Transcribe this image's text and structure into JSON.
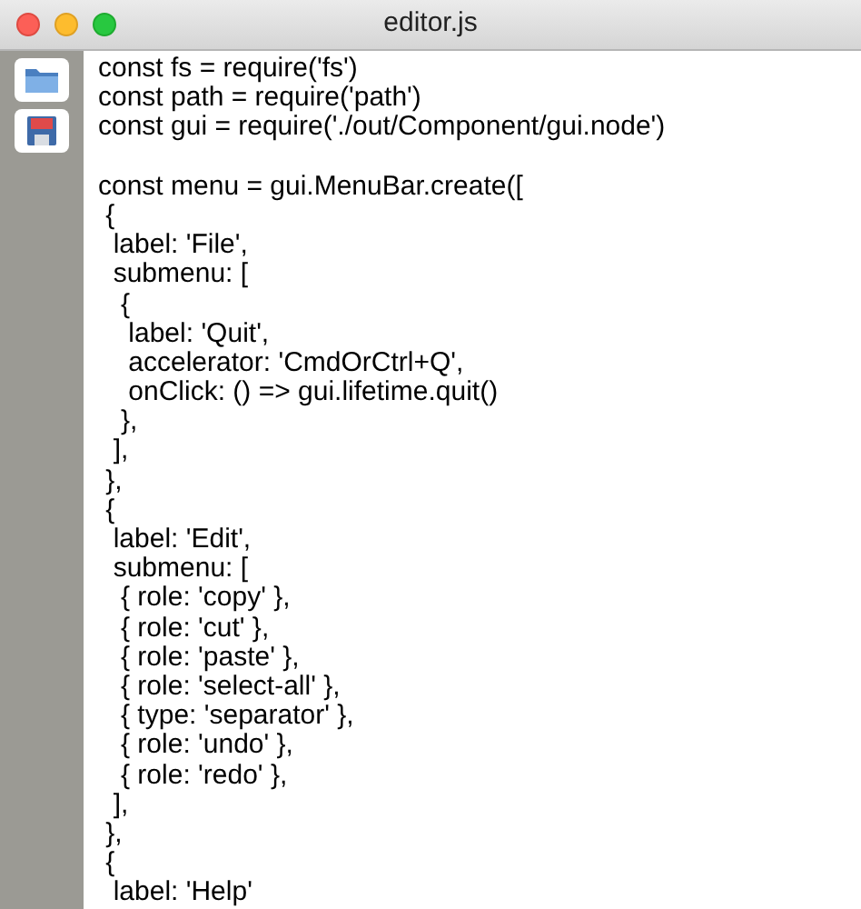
{
  "window": {
    "title": "editor.js"
  },
  "toolbar": [
    {
      "kind": "open"
    },
    {
      "kind": "save"
    }
  ],
  "editor": {
    "lines": [
      {
        "kind": "code",
        "text": "const fs = require('fs')"
      },
      {
        "kind": "code",
        "text": "const path = require('path')"
      },
      {
        "kind": "code",
        "text": "const gui = require('./out/Component/gui.node')"
      },
      {
        "kind": "blank"
      },
      {
        "kind": "code",
        "text": "const menu = gui.MenuBar.create(["
      },
      {
        "kind": "code",
        "text": " {"
      },
      {
        "kind": "code",
        "text": "  label: 'File',"
      },
      {
        "kind": "code",
        "text": "  submenu: ["
      },
      {
        "kind": "code",
        "text": "   {"
      },
      {
        "kind": "code",
        "text": "    label: 'Quit',"
      },
      {
        "kind": "code",
        "text": "    accelerator: 'CmdOrCtrl+Q',"
      },
      {
        "kind": "code",
        "text": "    onClick: () => gui.lifetime.quit()"
      },
      {
        "kind": "code",
        "text": "   },"
      },
      {
        "kind": "code",
        "text": "  ],"
      },
      {
        "kind": "code",
        "text": " },"
      },
      {
        "kind": "code",
        "text": " {"
      },
      {
        "kind": "code",
        "text": "  label: 'Edit',"
      },
      {
        "kind": "code",
        "text": "  submenu: ["
      },
      {
        "kind": "code",
        "text": "   { role: 'copy' },"
      },
      {
        "kind": "code",
        "text": "   { role: 'cut' },"
      },
      {
        "kind": "code",
        "text": "   { role: 'paste' },"
      },
      {
        "kind": "code",
        "text": "   { role: 'select-all' },"
      },
      {
        "kind": "code",
        "text": "   { type: 'separator' },"
      },
      {
        "kind": "code",
        "text": "   { role: 'undo' },"
      },
      {
        "kind": "code",
        "text": "   { role: 'redo' },"
      },
      {
        "kind": "code",
        "text": "  ],"
      },
      {
        "kind": "code",
        "text": " },"
      },
      {
        "kind": "code",
        "text": " {"
      },
      {
        "kind": "code",
        "text": "  label: 'Help'"
      }
    ]
  }
}
